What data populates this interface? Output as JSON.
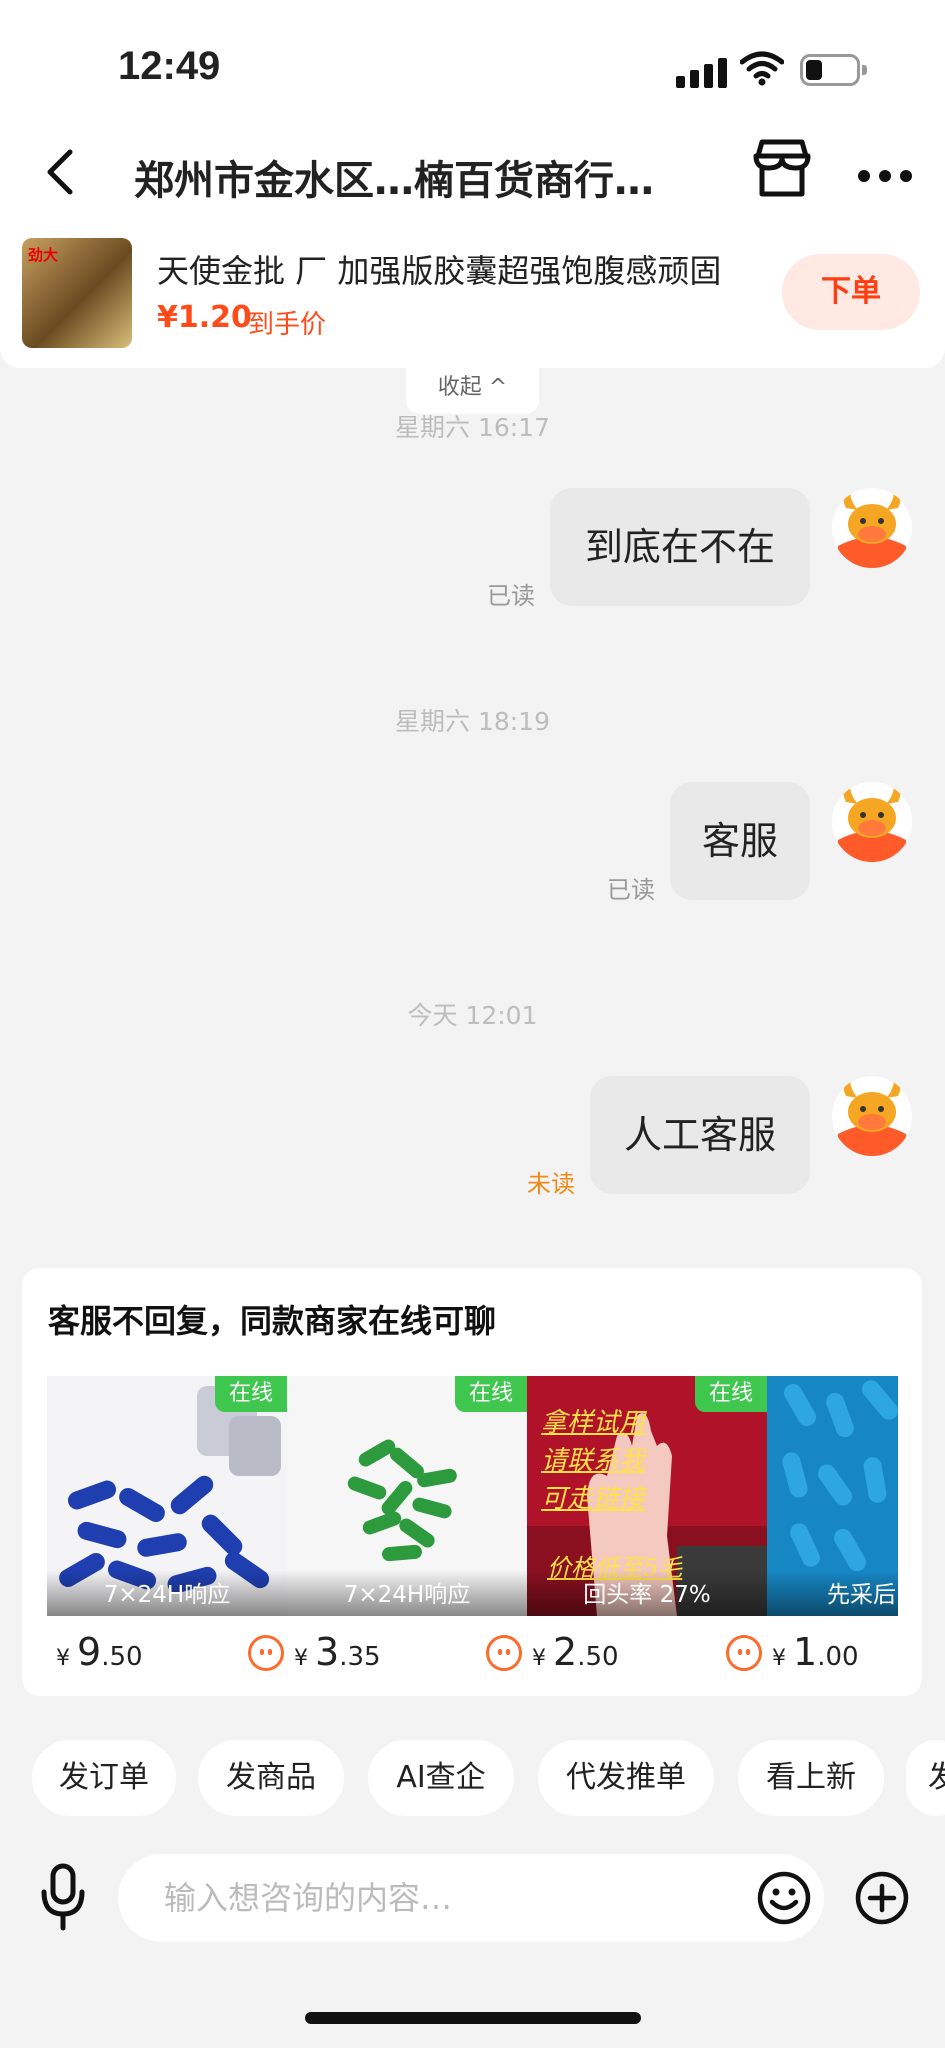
{
  "status_bar": {
    "time": "12:49"
  },
  "header": {
    "title": "郑州市金水区…楠百货商行…"
  },
  "product": {
    "name": "天使金批 厂 加强版胶囊超强饱腹感顽固",
    "price": "¥1.20",
    "price_note": "到手价",
    "order_button": "下单",
    "thumb_text": "劲大"
  },
  "collapse_label": "收起 ^",
  "messages": [
    {
      "timestamp": "星期六 16:17",
      "text": "到底在不在",
      "status": "已读"
    },
    {
      "timestamp": "星期六 18:19",
      "text": "客服",
      "status": "已读"
    },
    {
      "timestamp": "今天 12:01",
      "text": "人工客服",
      "status": "未读"
    }
  ],
  "recommend": {
    "title": "客服不回复，同款商家在线可聊",
    "shops": [
      {
        "badge": "在线",
        "caption": "7×24H响应",
        "price_int": "9",
        "price_dec": ".50",
        "currency": "¥"
      },
      {
        "badge": "在线",
        "caption": "7×24H响应",
        "price_int": "3",
        "price_dec": ".35",
        "currency": "¥"
      },
      {
        "badge": "在线",
        "caption": "回头率 27%",
        "price_int": "2",
        "price_dec": ".50",
        "currency": "¥",
        "overlay_lines": [
          "拿样试用",
          "请联系我",
          "可走链接",
          "价格低至5毛"
        ]
      },
      {
        "badge": "",
        "caption": "先采后",
        "price_int": "1",
        "price_dec": ".00",
        "currency": "¥"
      }
    ]
  },
  "quick_actions": [
    "发订单",
    "发商品",
    "AI查企",
    "代发推单",
    "看上新",
    "发"
  ],
  "input": {
    "placeholder": "输入想咨询的内容…"
  },
  "colors": {
    "accent": "#ff4b19",
    "online": "#3fc74f",
    "unread": "#f08a16"
  }
}
